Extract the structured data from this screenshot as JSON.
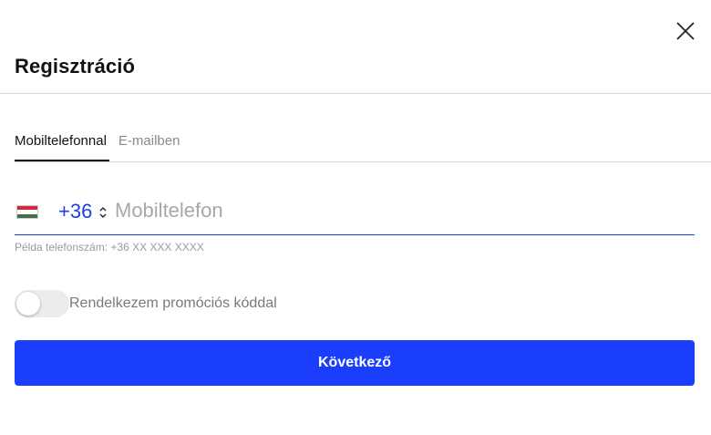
{
  "header": {
    "title": "Regisztráció",
    "close_icon": "close-icon"
  },
  "tabs": [
    {
      "label": "Mobiltelefonnal",
      "active": true
    },
    {
      "label": "E-mailben",
      "active": false
    }
  ],
  "phone": {
    "flag_icon": "hungary-flag-icon",
    "country_code": "+36",
    "placeholder": "Mobiltelefon",
    "value": "",
    "hint": "Példa telefonszám: +36 XX XXX XXXX"
  },
  "promo": {
    "label": "Rendelkezem promóciós kóddal",
    "enabled": false
  },
  "actions": {
    "next_label": "Következő"
  },
  "colors": {
    "accent": "#1a3efc",
    "code_text": "#1a3ee8"
  }
}
